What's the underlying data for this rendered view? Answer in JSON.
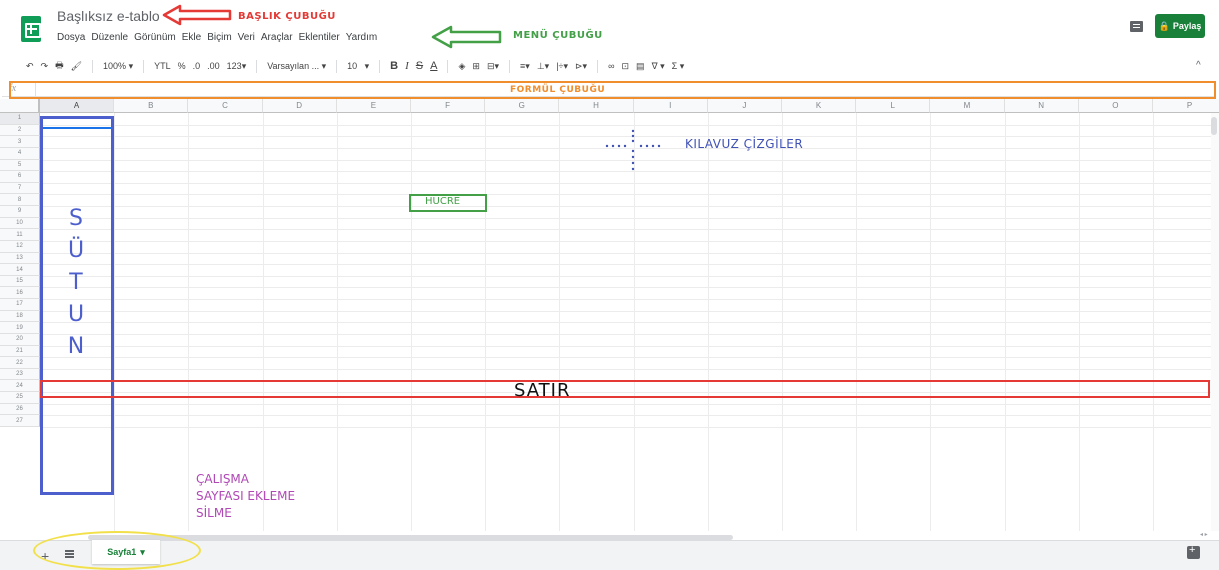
{
  "app": {
    "title": "Başlıksız e-tablo",
    "share_label": "Paylaş",
    "share_icon": "lock-icon"
  },
  "menu": [
    {
      "label": "Dosya"
    },
    {
      "label": "Düzenle"
    },
    {
      "label": "Görünüm"
    },
    {
      "label": "Ekle"
    },
    {
      "label": "Biçim"
    },
    {
      "label": "Veri"
    },
    {
      "label": "Araçlar"
    },
    {
      "label": "Eklentiler"
    },
    {
      "label": "Yardım"
    }
  ],
  "toolbar": {
    "undo": "↶",
    "redo": "↷",
    "print": "🖶",
    "paint_format": "🖌",
    "zoom": "100%",
    "currency": "YTL",
    "percent": "%",
    "decrease_decimal": ".0",
    "increase_decimal": ".00",
    "more_formats": "123",
    "font": "Varsayılan ...",
    "font_size": "10",
    "bold": "B",
    "italic": "I",
    "strike": "S",
    "text_color": "A",
    "fill": "◈",
    "borders": "⊞",
    "merge": "⊟",
    "align_h": "≡",
    "align_v": "⊥",
    "wrap": "|÷",
    "rotate": "⊳",
    "link": "∞",
    "comment": "⊡",
    "chart": "▤",
    "filter": "∇",
    "functions": "Σ",
    "collapse": "^"
  },
  "formula_bar": {
    "fx": "fx"
  },
  "grid": {
    "columns": [
      "A",
      "B",
      "C",
      "D",
      "E",
      "F",
      "G",
      "H",
      "I",
      "J",
      "K",
      "L",
      "M",
      "N",
      "O",
      "P"
    ],
    "rows": [
      "1",
      "2",
      "3",
      "4",
      "5",
      "6",
      "7",
      "8",
      "9",
      "10",
      "11",
      "12",
      "13",
      "14",
      "15",
      "16",
      "17",
      "18",
      "19",
      "20",
      "21",
      "22",
      "23",
      "24",
      "25",
      "26",
      "27"
    ],
    "selected_column": "A",
    "selected_row": "1"
  },
  "sheets": [
    {
      "name": "Sayfa1",
      "active": true
    }
  ],
  "annotations": {
    "title_bar": "BAŞLIK ÇUBUĞU",
    "menu_bar": "MENÜ ÇUBUĞU",
    "formula_bar": "FORMÜL ÇUBUĞU",
    "gridlines": "KILAVUZ ÇİZGİLER",
    "cell": "HÜCRE",
    "column_letters": [
      "S",
      "Ü",
      "T",
      "U",
      "N"
    ],
    "row": "SATIR",
    "sheet_lines": [
      "ÇALIŞMA",
      "SAYFASI EKLEME",
      "SİLME"
    ]
  },
  "colors": {
    "sheets_green": "#0f9d58",
    "share_green": "#188038",
    "annotation_red": "#e53935",
    "annotation_green": "#43a047",
    "annotation_orange": "#f08d2c",
    "annotation_blue": "#4c5fcc",
    "annotation_purple": "#b048b5",
    "annotation_yellow": "#f2e04a"
  }
}
